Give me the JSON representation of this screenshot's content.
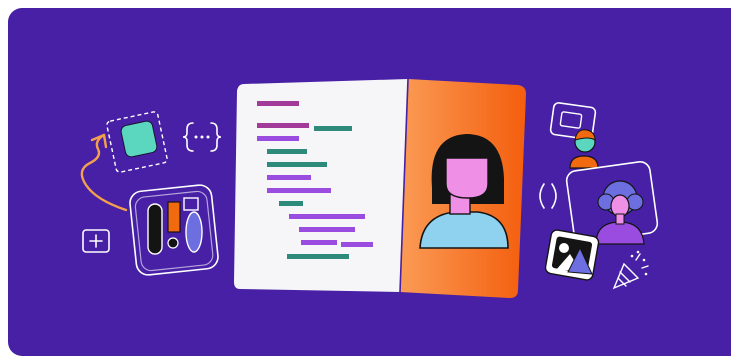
{
  "illustration": {
    "background_color": "#4720a6",
    "accent_colors": {
      "orange": "#f26a10",
      "teal": "#2e8a7b",
      "purple": "#9a4ce0",
      "magenta": "#a23a9a",
      "mint": "#5bd6bf",
      "pink": "#ef8fe6",
      "light_blue": "#8fd2f0",
      "paper": "#f6f5f7"
    },
    "icons": [
      "selection-square-icon",
      "curly-braces-icon",
      "curved-arrow-icon",
      "component-palette-icon",
      "plus-square-icon",
      "code-editor-card",
      "avatar-portrait",
      "video-call-icon",
      "parentheses-icon",
      "profile-photo-card",
      "image-frame-icon",
      "party-popper-icon"
    ]
  }
}
